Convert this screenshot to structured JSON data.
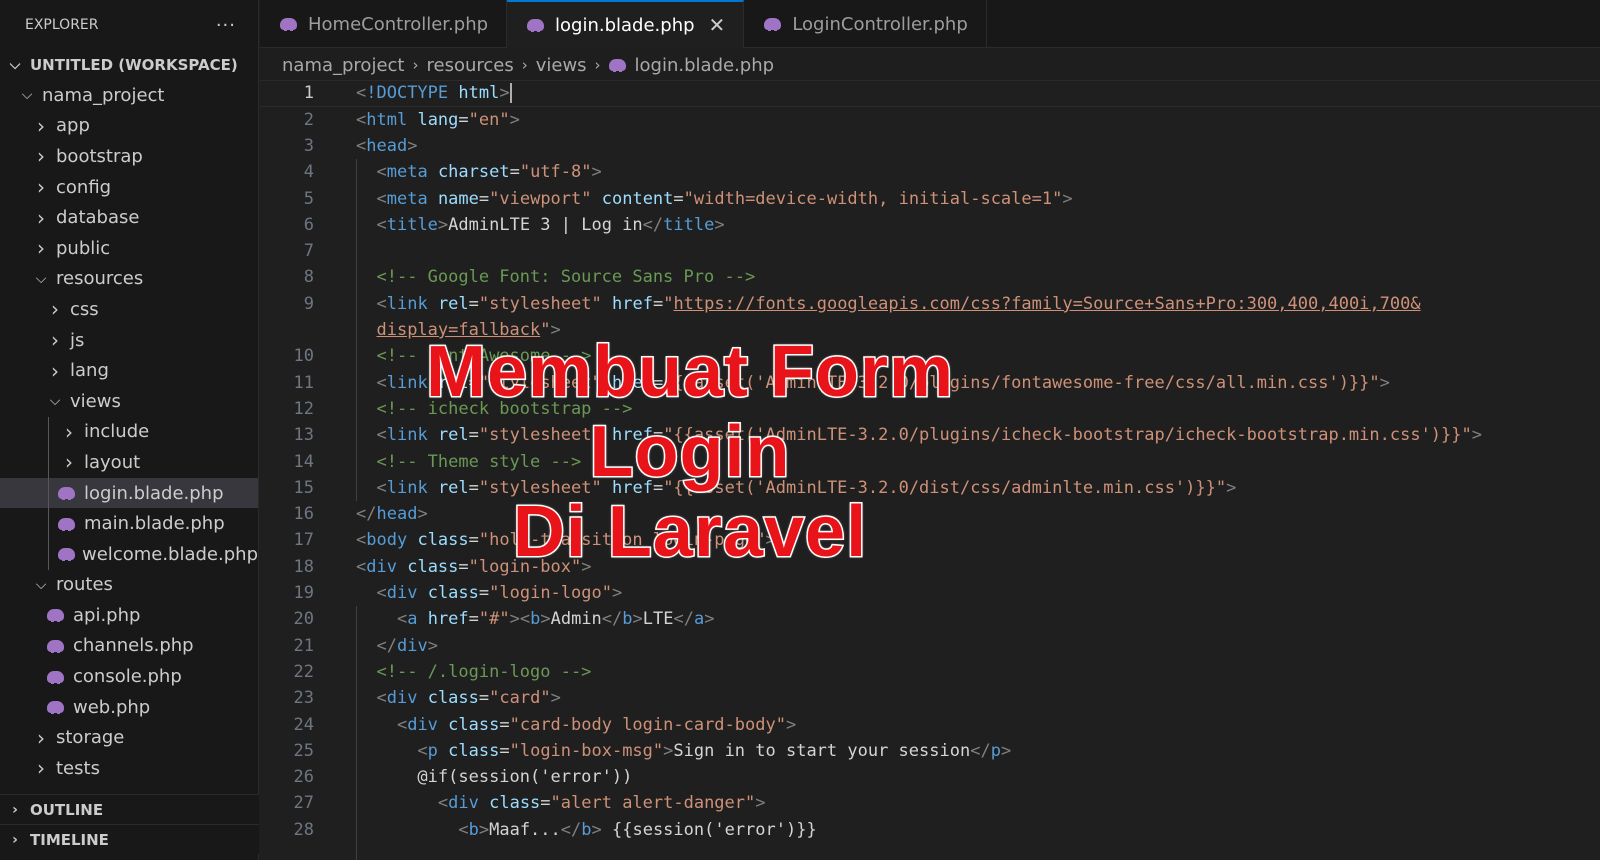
{
  "explorer": {
    "title": "EXPLORER",
    "more": "···",
    "workspace": "UNTITLED (WORKSPACE)",
    "tree": [
      {
        "label": "nama_project",
        "type": "folder",
        "open": true,
        "depth": 1
      },
      {
        "label": "app",
        "type": "folder",
        "open": false,
        "depth": 2
      },
      {
        "label": "bootstrap",
        "type": "folder",
        "open": false,
        "depth": 2
      },
      {
        "label": "config",
        "type": "folder",
        "open": false,
        "depth": 2
      },
      {
        "label": "database",
        "type": "folder",
        "open": false,
        "depth": 2
      },
      {
        "label": "public",
        "type": "folder",
        "open": false,
        "depth": 2
      },
      {
        "label": "resources",
        "type": "folder",
        "open": true,
        "depth": 2
      },
      {
        "label": "css",
        "type": "folder",
        "open": false,
        "depth": 3
      },
      {
        "label": "js",
        "type": "folder",
        "open": false,
        "depth": 3
      },
      {
        "label": "lang",
        "type": "folder",
        "open": false,
        "depth": 3
      },
      {
        "label": "views",
        "type": "folder",
        "open": true,
        "depth": 3
      },
      {
        "label": "include",
        "type": "folder",
        "open": false,
        "depth": 4
      },
      {
        "label": "layout",
        "type": "folder",
        "open": false,
        "depth": 4
      },
      {
        "label": "login.blade.php",
        "type": "file",
        "depth": 4,
        "selected": true
      },
      {
        "label": "main.blade.php",
        "type": "file",
        "depth": 4
      },
      {
        "label": "welcome.blade.php",
        "type": "file",
        "depth": 4
      },
      {
        "label": "routes",
        "type": "folder",
        "open": true,
        "depth": 2
      },
      {
        "label": "api.php",
        "type": "file",
        "depth": 3
      },
      {
        "label": "channels.php",
        "type": "file",
        "depth": 3
      },
      {
        "label": "console.php",
        "type": "file",
        "depth": 3
      },
      {
        "label": "web.php",
        "type": "file",
        "depth": 3
      },
      {
        "label": "storage",
        "type": "folder",
        "open": false,
        "depth": 2
      },
      {
        "label": "tests",
        "type": "folder",
        "open": false,
        "depth": 2
      }
    ],
    "outline": "OUTLINE",
    "timeline": "TIMELINE"
  },
  "tabs": [
    {
      "label": "HomeController.php",
      "active": false
    },
    {
      "label": "login.blade.php",
      "active": true
    },
    {
      "label": "LoginController.php",
      "active": false
    }
  ],
  "tab_close": "✕",
  "breadcrumb": [
    "nama_project",
    "resources",
    "views",
    "login.blade.php"
  ],
  "editor": {
    "active_line": 1,
    "lines": [
      {
        "n": "1",
        "html": "<span class='tg'>&lt;</span><span class='tn'>!DOCTYPE</span> <span class='at'>html</span><span class='tg'>&gt;</span><span class='cursor'></span>"
      },
      {
        "n": "2",
        "html": "<span class='tg'>&lt;</span><span class='tn'>html</span> <span class='at'>lang</span><span class='tx'>=</span><span class='st'>\"en\"</span><span class='tg'>&gt;</span>"
      },
      {
        "n": "3",
        "html": "<span class='tg'>&lt;</span><span class='tn'>head</span><span class='tg'>&gt;</span>"
      },
      {
        "n": "4",
        "html": "  <span class='tg'>&lt;</span><span class='tn'>meta</span> <span class='at'>charset</span><span class='tx'>=</span><span class='st'>\"utf-8\"</span><span class='tg'>&gt;</span>"
      },
      {
        "n": "5",
        "html": "  <span class='tg'>&lt;</span><span class='tn'>meta</span> <span class='at'>name</span><span class='tx'>=</span><span class='st'>\"viewport\"</span> <span class='at'>content</span><span class='tx'>=</span><span class='st'>\"width=device-width, initial-scale=1\"</span><span class='tg'>&gt;</span>"
      },
      {
        "n": "6",
        "html": "  <span class='tg'>&lt;</span><span class='tn'>title</span><span class='tg'>&gt;</span><span class='tx'>AdminLTE 3 | Log in</span><span class='tg'>&lt;/</span><span class='tn'>title</span><span class='tg'>&gt;</span>"
      },
      {
        "n": "7",
        "html": ""
      },
      {
        "n": "8",
        "html": "  <span class='cm'>&lt;!-- Google Font: Source Sans Pro --&gt;</span>"
      },
      {
        "n": "9",
        "html": "  <span class='tg'>&lt;</span><span class='tn'>link</span> <span class='at'>rel</span><span class='tx'>=</span><span class='st'>\"stylesheet\"</span> <span class='at'>href</span><span class='tx'>=</span><span class='st'>\"</span><span class='url'>https://fonts.googleapis.com/css?family=Source+Sans+Pro:300,400,400i,700&amp;</span>"
      },
      {
        "n": "",
        "html": "  <span class='url'>display=fallback</span><span class='st'>\"</span><span class='tg'>&gt;</span>"
      },
      {
        "n": "10",
        "html": "  <span class='cm'>&lt;!-- Font Awesome --&gt;</span>"
      },
      {
        "n": "11",
        "html": "  <span class='tg'>&lt;</span><span class='tn'>link</span> <span class='at'>rel</span><span class='tx'>=</span><span class='st'>\"stylesheet\"</span> <span class='at'>href</span><span class='tx'>=</span><span class='st'>\"{{asset('AdminLTE-3.2.0/plugins/fontawesome-free/css/all.min.css')}}\"</span><span class='tg'>&gt;</span>"
      },
      {
        "n": "12",
        "html": "  <span class='cm'>&lt;!-- icheck bootstrap --&gt;</span>"
      },
      {
        "n": "13",
        "html": "  <span class='tg'>&lt;</span><span class='tn'>link</span> <span class='at'>rel</span><span class='tx'>=</span><span class='st'>\"stylesheet\"</span> <span class='at'>href</span><span class='tx'>=</span><span class='st'>\"{{asset('AdminLTE-3.2.0/plugins/icheck-bootstrap/icheck-bootstrap.min.css')}}\"</span><span class='tg'>&gt;</span>"
      },
      {
        "n": "14",
        "html": "  <span class='cm'>&lt;!-- Theme style --&gt;</span>"
      },
      {
        "n": "15",
        "html": "  <span class='tg'>&lt;</span><span class='tn'>link</span> <span class='at'>rel</span><span class='tx'>=</span><span class='st'>\"stylesheet\"</span> <span class='at'>href</span><span class='tx'>=</span><span class='st'>\"{{asset('AdminLTE-3.2.0/dist/css/adminlte.min.css')}}\"</span><span class='tg'>&gt;</span>"
      },
      {
        "n": "16",
        "html": "<span class='tg'>&lt;/</span><span class='tn'>head</span><span class='tg'>&gt;</span>"
      },
      {
        "n": "17",
        "html": "<span class='tg'>&lt;</span><span class='tn'>body</span> <span class='at'>class</span><span class='tx'>=</span><span class='st'>\"hold-transition login-page\"</span><span class='tg'>&gt;</span>"
      },
      {
        "n": "18",
        "html": "<span class='tg'>&lt;</span><span class='tn'>div</span> <span class='at'>class</span><span class='tx'>=</span><span class='st'>\"login-box\"</span><span class='tg'>&gt;</span>"
      },
      {
        "n": "19",
        "html": "  <span class='tg'>&lt;</span><span class='tn'>div</span> <span class='at'>class</span><span class='tx'>=</span><span class='st'>\"login-logo\"</span><span class='tg'>&gt;</span>"
      },
      {
        "n": "20",
        "html": "    <span class='tg'>&lt;</span><span class='tn'>a</span> <span class='at'>href</span><span class='tx'>=</span><span class='st'>\"#\"</span><span class='tg'>&gt;&lt;</span><span class='tn'>b</span><span class='tg'>&gt;</span><span class='tx'>Admin</span><span class='tg'>&lt;/</span><span class='tn'>b</span><span class='tg'>&gt;</span><span class='tx'>LTE</span><span class='tg'>&lt;/</span><span class='tn'>a</span><span class='tg'>&gt;</span>"
      },
      {
        "n": "21",
        "html": "  <span class='tg'>&lt;/</span><span class='tn'>div</span><span class='tg'>&gt;</span>"
      },
      {
        "n": "22",
        "html": "  <span class='cm'>&lt;!-- /.login-logo --&gt;</span>"
      },
      {
        "n": "23",
        "html": "  <span class='tg'>&lt;</span><span class='tn'>div</span> <span class='at'>class</span><span class='tx'>=</span><span class='st'>\"card\"</span><span class='tg'>&gt;</span>"
      },
      {
        "n": "24",
        "html": "    <span class='tg'>&lt;</span><span class='tn'>div</span> <span class='at'>class</span><span class='tx'>=</span><span class='st'>\"card-body login-card-body\"</span><span class='tg'>&gt;</span>"
      },
      {
        "n": "25",
        "html": "      <span class='tg'>&lt;</span><span class='tn'>p</span> <span class='at'>class</span><span class='tx'>=</span><span class='st'>\"login-box-msg\"</span><span class='tg'>&gt;</span><span class='tx'>Sign in to start your session</span><span class='tg'>&lt;/</span><span class='tn'>p</span><span class='tg'>&gt;</span>"
      },
      {
        "n": "26",
        "html": "      <span class='tx'>@if(session('error'))</span>"
      },
      {
        "n": "27",
        "html": "        <span class='tg'>&lt;</span><span class='tn'>div</span> <span class='at'>class</span><span class='tx'>=</span><span class='st'>\"alert alert-danger\"</span><span class='tg'>&gt;</span>"
      },
      {
        "n": "28",
        "html": "          <span class='tg'>&lt;</span><span class='tn'>b</span><span class='tg'>&gt;</span><span class='tx'>Maaf...</span><span class='tg'>&lt;/</span><span class='tn'>b</span><span class='tg'>&gt;</span> <span class='tx'>{{session('error')}}</span>"
      }
    ]
  },
  "overlay": {
    "line1": "Membuat Form Login",
    "line2": "Di Laravel"
  },
  "colors": {
    "accent": "#0078d4",
    "php_icon": "#a074c4",
    "overlay_text": "#e8141a"
  }
}
